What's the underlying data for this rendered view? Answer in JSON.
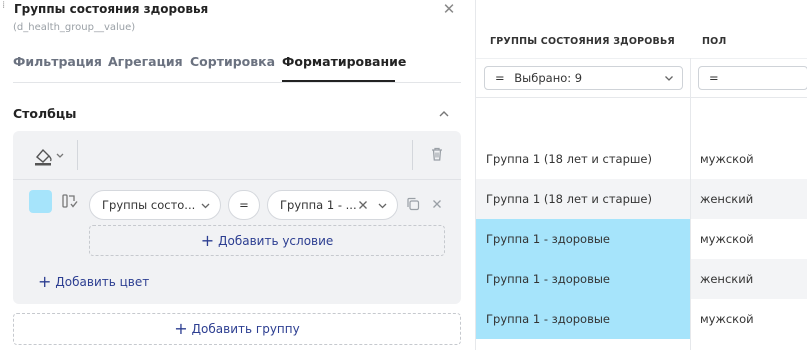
{
  "panel": {
    "title": "Группы состояния здоровья",
    "subtitle": "(d_health_group__value)",
    "tabs": [
      {
        "label": "Фильтрация"
      },
      {
        "label": "Агрегация"
      },
      {
        "label": "Сортировка"
      },
      {
        "label": "Форматирование"
      }
    ],
    "active_tab": "Форматирование",
    "section_label": "Столбцы",
    "rule": {
      "color": "#a6e4fb",
      "field": "Группы состо...",
      "operator": "=",
      "value": "Группа 1 - ..."
    },
    "add_condition_label": "Добавить условие",
    "add_color_label": "Добавить цвет",
    "add_group_label": "Добавить группу",
    "accent_color": "#2c3e91"
  },
  "table": {
    "columns": [
      {
        "header": "ГРУППЫ СОСТОЯНИЯ ЗДОРОВЬЯ",
        "filter": "Выбрано: 9",
        "filter_op": "="
      },
      {
        "header": "ПОЛ",
        "filter": "",
        "filter_op": "="
      }
    ],
    "rows": [
      {
        "group": "",
        "sex": ""
      },
      {
        "group": "Группа 1 (18 лет и старше)",
        "sex": "мужской"
      },
      {
        "group": "Группа 1 (18 лет и старше)",
        "sex": "женский"
      },
      {
        "group": "Группа 1 - здоровые",
        "sex": "мужской"
      },
      {
        "group": "Группа 1 - здоровые",
        "sex": "женский"
      },
      {
        "group": "Группа 1 - здоровые",
        "sex": "мужской"
      }
    ],
    "highlight_color": "#a6e4fb",
    "stripe_color": "#f3f4f6"
  }
}
